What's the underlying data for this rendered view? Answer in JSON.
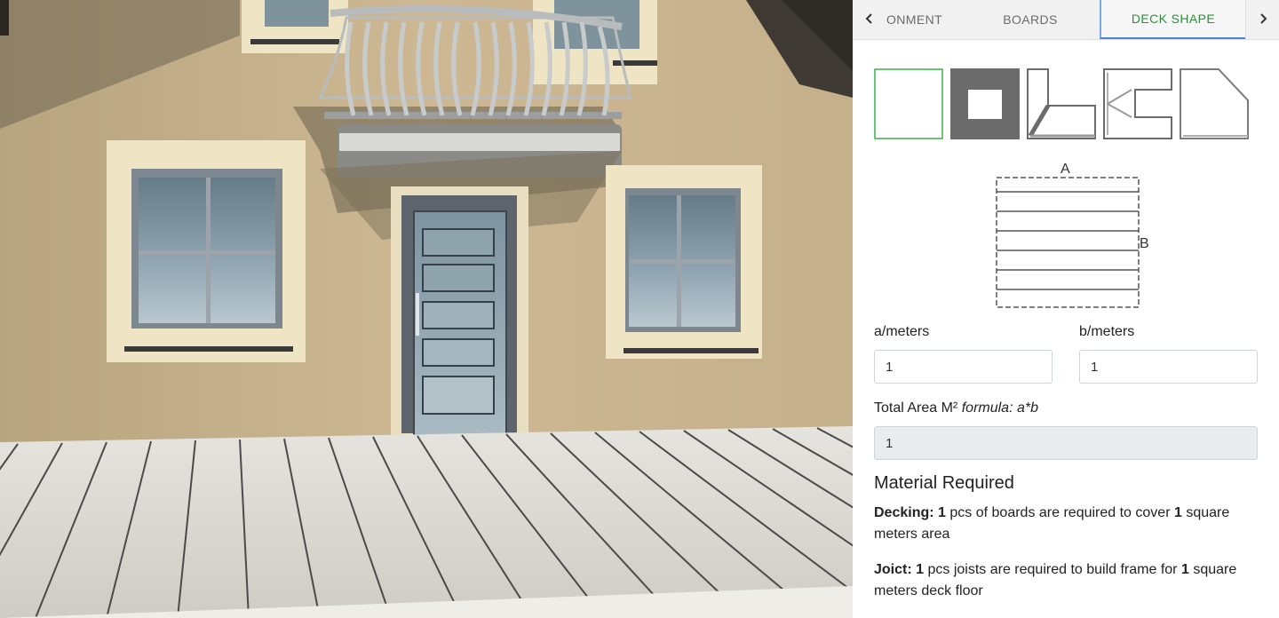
{
  "tabs": [
    {
      "label": "ONMENT"
    },
    {
      "label": "BOARDS"
    },
    {
      "label": "DECK SHAPE",
      "active": true
    }
  ],
  "nav": {
    "prev_icon": "chevron-left-icon",
    "next_icon": "chevron-right-icon"
  },
  "shapes": {
    "selected_index": 0,
    "options": [
      "square-shape",
      "frame-shape",
      "l-shape",
      "u-shape",
      "cut-corner-shape"
    ]
  },
  "diagram": {
    "label_a": "A",
    "label_b": "B"
  },
  "inputs": {
    "a_label": "a/meters",
    "a_value": "1",
    "b_label": "b/meters",
    "b_value": "1"
  },
  "total": {
    "label": "Total Area M²",
    "formula": "formula: a*b",
    "value": "1"
  },
  "material": {
    "title": "Material Required",
    "decking": {
      "label": "Decking:",
      "count": "1",
      "text1": "pcs of boards are required to cover",
      "area": "1",
      "text2": "square meters area"
    },
    "joist": {
      "label": "Joict:",
      "count": "1",
      "text1": "pcs joists are required to build frame for",
      "area": "1",
      "text2": "square meters deck floor"
    }
  },
  "colors": {
    "accent_green": "#2e8b3d",
    "tab_underline": "#4f86d1",
    "wall": "#c9b592",
    "deck": "#d8d6d0"
  }
}
